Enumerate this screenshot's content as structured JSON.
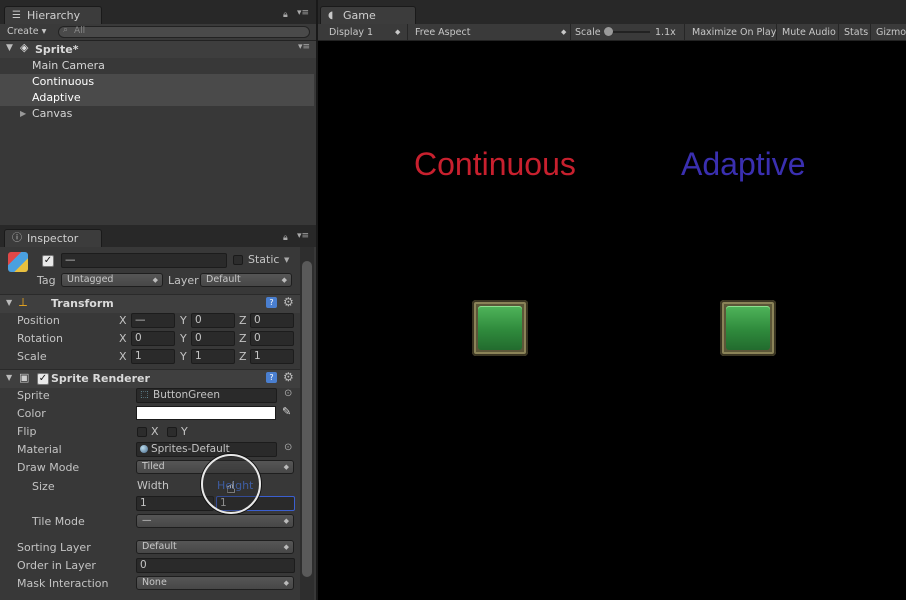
{
  "hierarchy": {
    "tab_label": "Hierarchy",
    "create_label": "Create",
    "search_placeholder": "All",
    "scene_name": "Sprite*",
    "items": [
      {
        "label": "Main Camera"
      },
      {
        "label": "Continuous"
      },
      {
        "label": "Adaptive"
      },
      {
        "label": "Canvas"
      }
    ]
  },
  "inspector": {
    "tab_label": "Inspector",
    "object_name": "—",
    "static_label": "Static",
    "tag_label": "Tag",
    "tag_value": "Untagged",
    "layer_label": "Layer",
    "layer_value": "Default",
    "transform": {
      "title": "Transform",
      "rows": [
        {
          "label": "Position",
          "x": "—",
          "y": "0",
          "z": "0"
        },
        {
          "label": "Rotation",
          "x": "0",
          "y": "0",
          "z": "0"
        },
        {
          "label": "Scale",
          "x": "1",
          "y": "1",
          "z": "1"
        }
      ],
      "axis_x": "X",
      "axis_y": "Y",
      "axis_z": "Z"
    },
    "sprite_renderer": {
      "title": "Sprite Renderer",
      "sprite_label": "Sprite",
      "sprite_value": "ButtonGreen",
      "color_label": "Color",
      "flip_label": "Flip",
      "flip_x": "X",
      "flip_y": "Y",
      "material_label": "Material",
      "material_value": "Sprites-Default",
      "draw_mode_label": "Draw Mode",
      "draw_mode_value": "Tiled",
      "size_label": "Size",
      "width_label": "Width",
      "height_label": "Height",
      "width_value": "1",
      "height_value": "1",
      "tile_mode_label": "Tile Mode",
      "tile_mode_value": "—",
      "sorting_layer_label": "Sorting Layer",
      "sorting_layer_value": "Default",
      "order_label": "Order in Layer",
      "order_value": "0",
      "mask_label": "Mask Interaction",
      "mask_value": "None"
    }
  },
  "game": {
    "tab_label": "Game",
    "display": "Display 1",
    "aspect": "Free Aspect",
    "scale_label": "Scale",
    "scale_value": "1.1x",
    "maximize": "Maximize On Play",
    "mute": "Mute Audio",
    "stats": "Stats",
    "gizmos": "Gizmos",
    "label_continuous": "Continuous",
    "label_adaptive": "Adaptive",
    "color_continuous": "#c8202e",
    "color_adaptive": "#3a2fb0"
  }
}
